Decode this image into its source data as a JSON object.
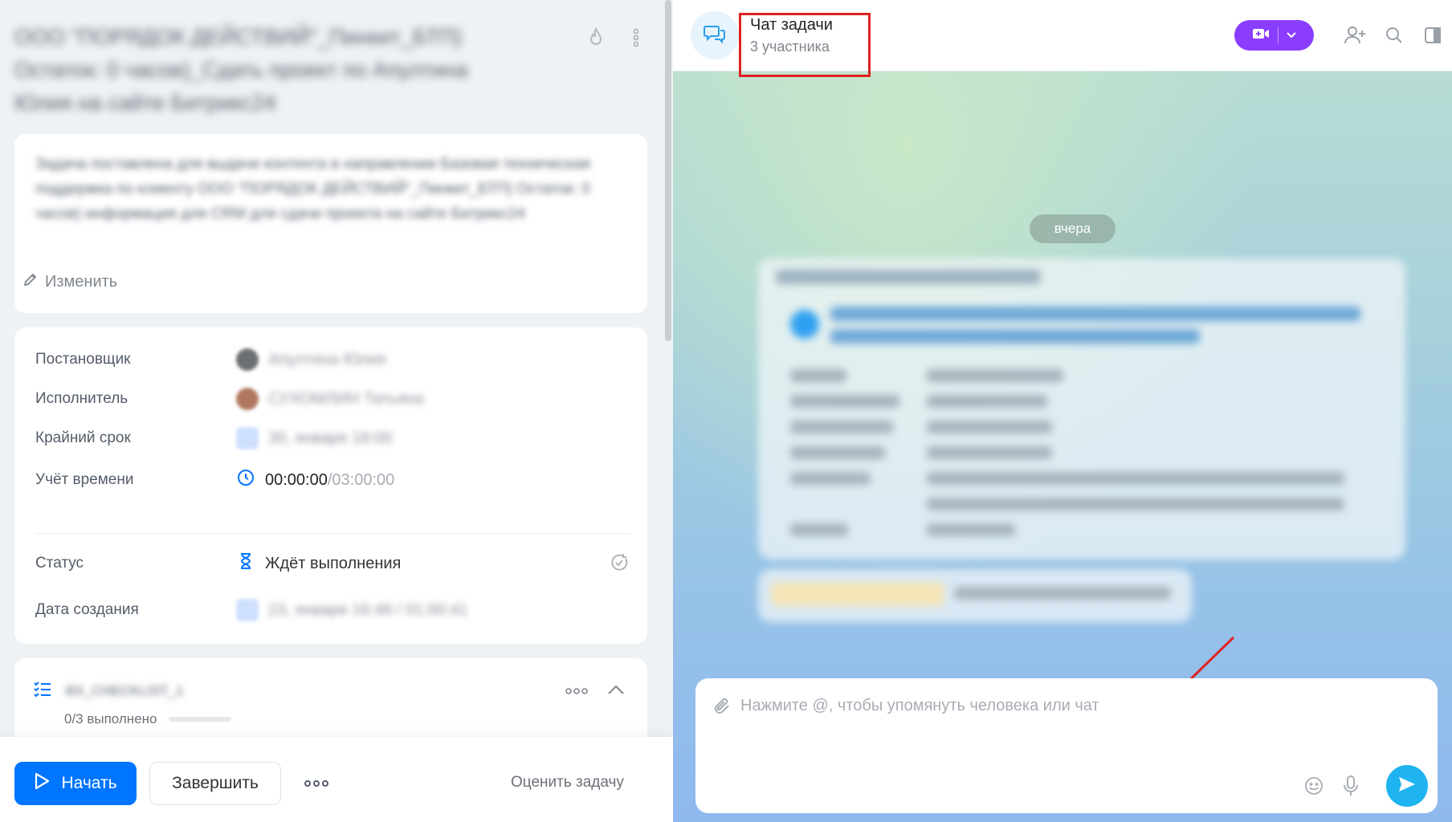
{
  "task": {
    "title": "ООО \"ПОРЯДОК ДЕЙСТВИЙ\"_Пинкит_БТП) Остаток: 0 часов)_Сдать проект по Апултина Юлия на сайте Битрикс24",
    "description": "Задача поставлена для выдачи контента в направлении Базовая техническая поддержка по клиенту ООО \"ПОРЯДОК ДЕЙСТВИЙ\"_Пинкит_БТП) Остаток: 0 часов) информация для CRM для сдачи проекта на сайте Битрикс24",
    "edit_label": "Изменить"
  },
  "props": {
    "creator_label": "Постановщик",
    "creator_value": "Апултина Юлия",
    "assignee_label": "Исполнитель",
    "assignee_value": "СУХОМЛИН Татьяна",
    "deadline_label": "Крайний срок",
    "deadline_value": "30, января 18:00",
    "time_label": "Учёт времени",
    "time_spent": "00:00:00",
    "time_sep": "/",
    "time_total": "03:00:00",
    "status_label": "Статус",
    "status_value": "Ждёт выполнения",
    "created_label": "Дата создания",
    "created_value": "23, января 16:48 / 01:00:41"
  },
  "checklist": {
    "title": "BX_CHECKLIST_1",
    "progress_text": "0/3 выполнено",
    "progress_fraction": 0
  },
  "footer": {
    "start_label": "Начать",
    "finish_label": "Завершить",
    "more_label": "ooo",
    "rate_label": "Оценить задачу"
  },
  "chat": {
    "title": "Чат задачи",
    "subtitle": "3 участника",
    "date_label": "вчера",
    "input_placeholder": "Нажмите @, чтобы упомянуть человека или чат",
    "input_value": ""
  },
  "colors": {
    "primary_blue": "#0075ff",
    "video_purple": "#8b3dff",
    "send_blue": "#1fb4f0",
    "highlight_red": "#e02020"
  },
  "icons": [
    "fire-icon",
    "kebab-icon",
    "pencil-icon",
    "calendar-icon",
    "clock-icon",
    "hourglass-icon",
    "repeat-check-icon",
    "checklist-icon",
    "play-icon",
    "chat-bubbles-icon",
    "video-camera-icon",
    "chevron-down-icon",
    "add-user-icon",
    "search-icon",
    "sidebar-icon",
    "paperclip-icon",
    "emoji-icon",
    "microphone-icon",
    "send-icon"
  ]
}
